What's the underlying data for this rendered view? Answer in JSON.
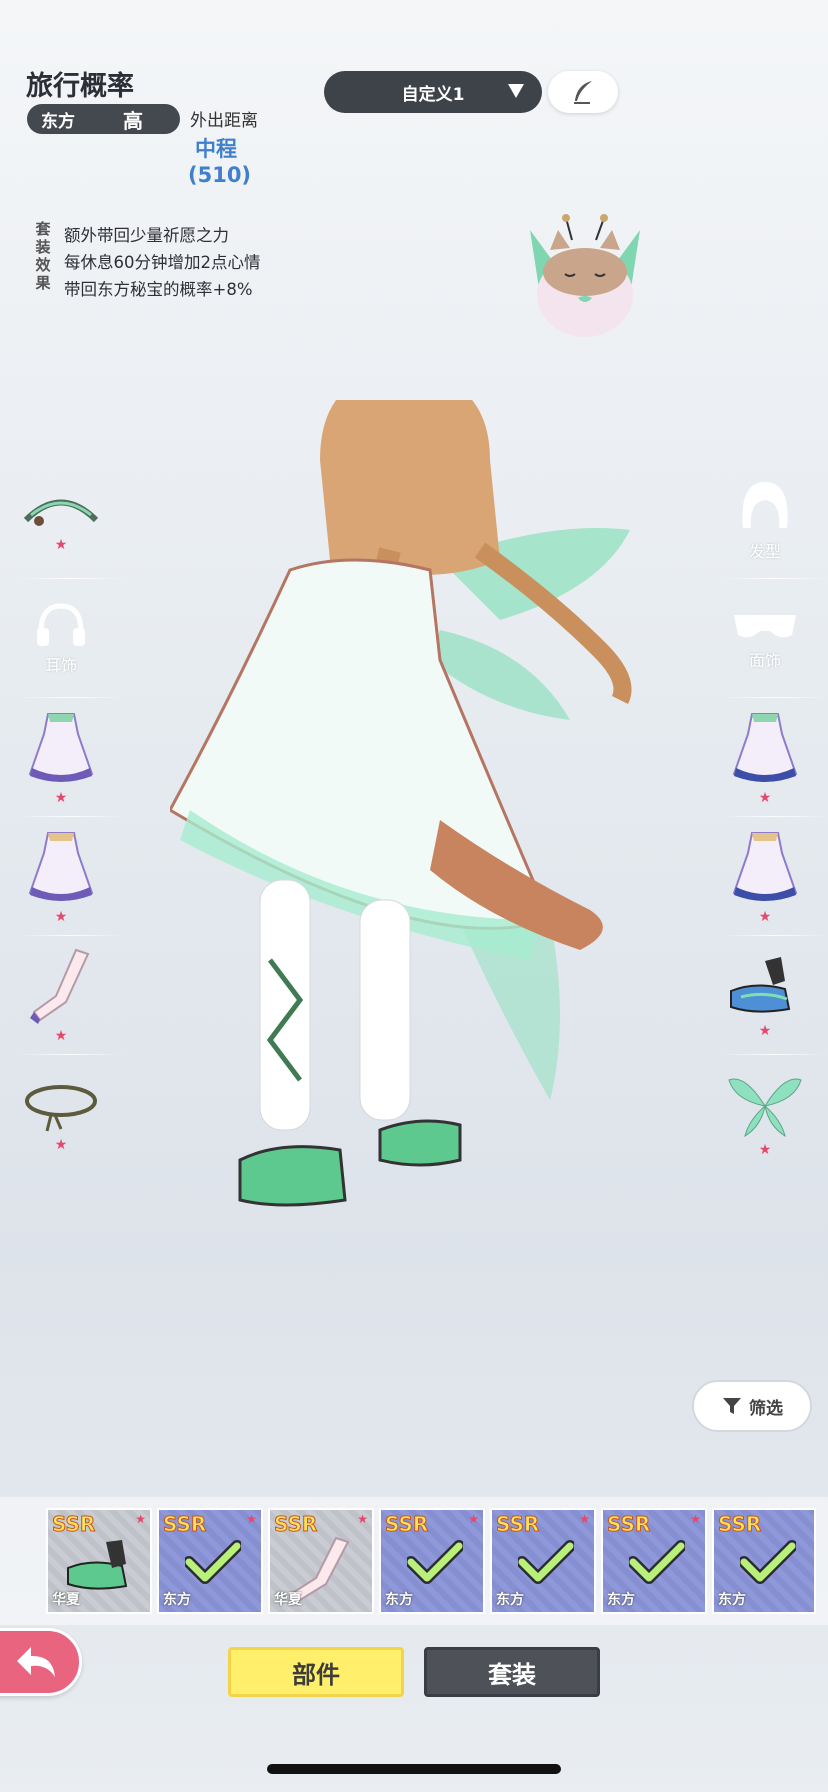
{
  "header": {
    "title": "旅行概率",
    "region": "东方",
    "region_level": "高",
    "distance_label": "外出距离",
    "distance_value": "中程",
    "distance_number": "(510)"
  },
  "set_effect": {
    "tag": [
      "套",
      "装",
      "效",
      "果"
    ],
    "lines": [
      "额外带回少量祈愿之力",
      "每休息60分钟增加2点心情",
      "带回东方秘宝的概率+8%"
    ]
  },
  "preset": {
    "label": "自定义1",
    "edit_icon": "feather-pen-icon"
  },
  "left_slots": [
    {
      "name": "headpiece",
      "label": "",
      "has_item": true
    },
    {
      "name": "ear-accessory",
      "label": "耳饰",
      "has_item": false
    },
    {
      "name": "dress-1",
      "label": "",
      "has_item": true
    },
    {
      "name": "dress-2",
      "label": "",
      "has_item": true
    },
    {
      "name": "stockings",
      "label": "",
      "has_item": true
    },
    {
      "name": "anklet",
      "label": "",
      "has_item": true
    }
  ],
  "right_slots": [
    {
      "name": "hairstyle",
      "label": "发型",
      "has_item": false
    },
    {
      "name": "face-accessory",
      "label": "面饰",
      "has_item": false
    },
    {
      "name": "dress-3",
      "label": "",
      "has_item": true
    },
    {
      "name": "dress-4",
      "label": "",
      "has_item": true
    },
    {
      "name": "shoes",
      "label": "",
      "has_item": true
    },
    {
      "name": "wings",
      "label": "",
      "has_item": true
    }
  ],
  "filter": {
    "label": "筛选"
  },
  "cards": [
    {
      "rarity": "SSR",
      "region": "华夏",
      "equipped": false,
      "color": "grey"
    },
    {
      "rarity": "SSR",
      "region": "东方",
      "equipped": true,
      "color": "blue"
    },
    {
      "rarity": "SSR",
      "region": "华夏",
      "equipped": false,
      "color": "grey"
    },
    {
      "rarity": "SSR",
      "region": "东方",
      "equipped": true,
      "color": "blue"
    },
    {
      "rarity": "SSR",
      "region": "东方",
      "equipped": true,
      "color": "blue"
    },
    {
      "rarity": "SSR",
      "region": "东方",
      "equipped": true,
      "color": "blue"
    },
    {
      "rarity": "SSR",
      "region": "东方",
      "equipped": true,
      "color": "blue"
    }
  ],
  "tabs": {
    "parts": "部件",
    "sets": "套装"
  },
  "colors": {
    "accent_blue": "#3f7fcc",
    "star_pink": "#e7476b",
    "tab_yellow": "#ffef6b",
    "dark_pill": "#3e4249"
  }
}
